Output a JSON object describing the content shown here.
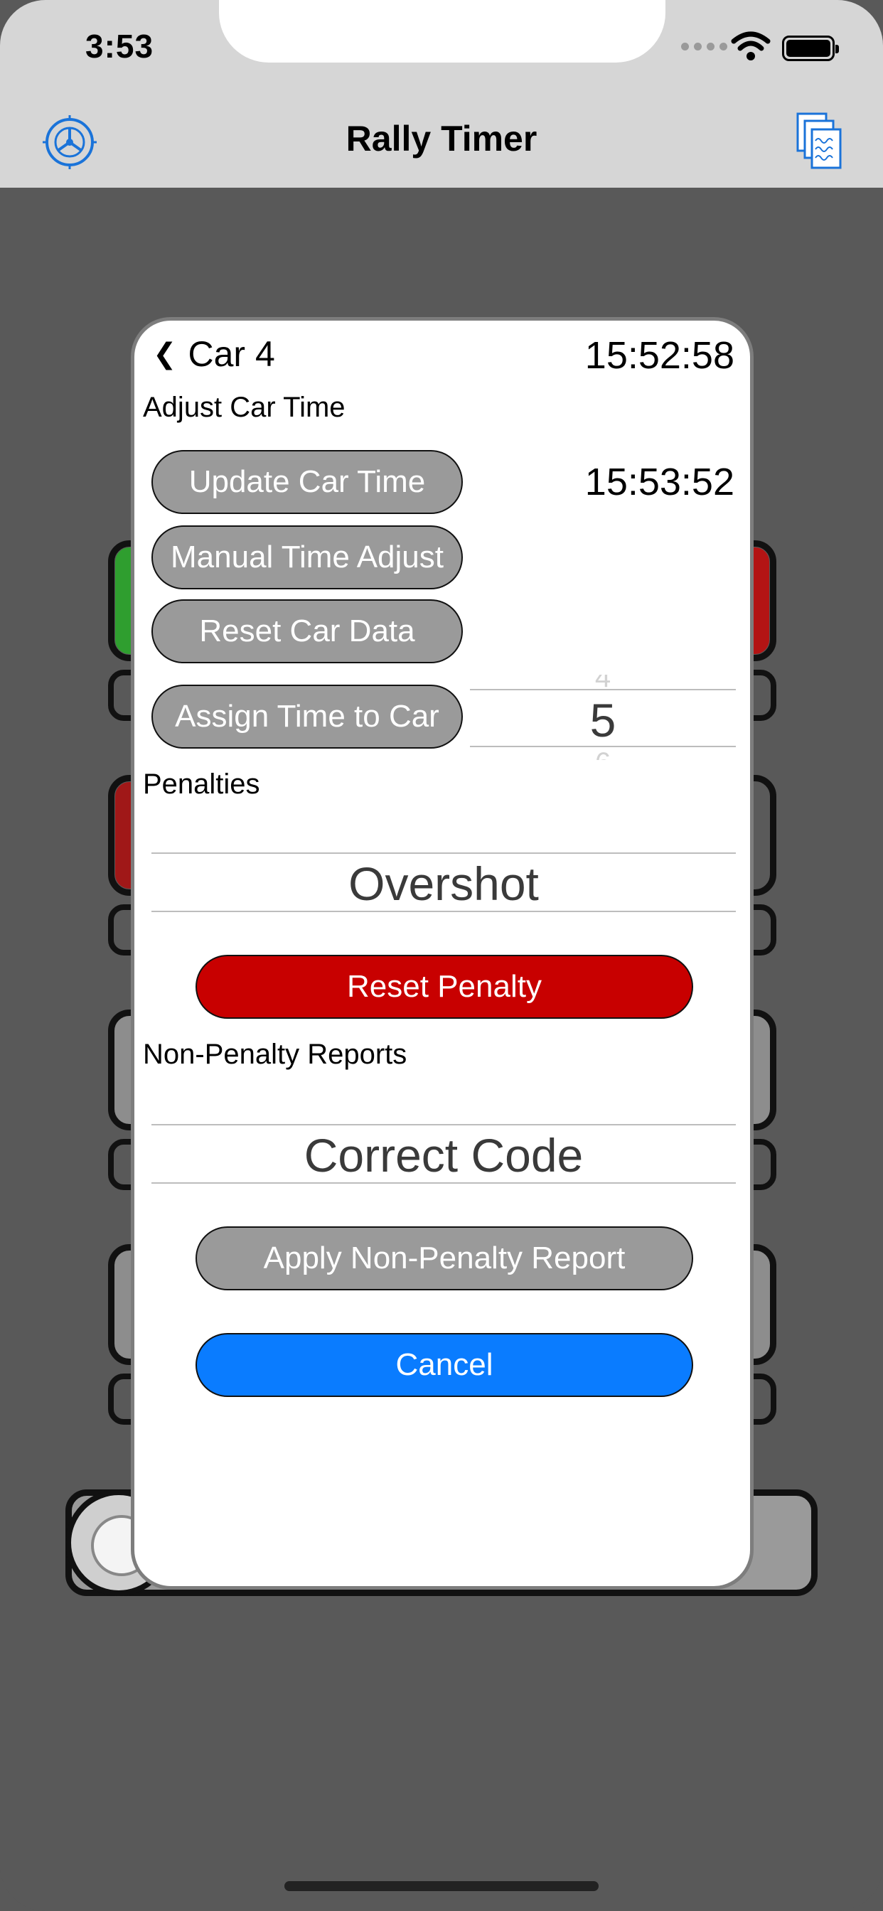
{
  "status_bar": {
    "time": "3:53"
  },
  "nav": {
    "title": "Rally Timer",
    "left_icon": "steering-wheel-icon",
    "right_icon": "documents-icon"
  },
  "modal": {
    "back_label": "Car 4",
    "back_chevron": "❮",
    "current_time": "15:52:58",
    "adjust_section": "Adjust Car Time",
    "update_car_time_label": "Update Car Time",
    "car_time_value": "15:53:52",
    "manual_time_adjust_label": "Manual Time Adjust",
    "reset_car_data_label": "Reset Car Data",
    "assign_time_label": "Assign Time to Car",
    "car_number_picker": {
      "selected": "5"
    },
    "penalties_section": "Penalties",
    "penalty_picker": {
      "selected": "Overshot"
    },
    "reset_penalty_label": "Reset Penalty",
    "non_penalty_section": "Non-Penalty Reports",
    "report_picker": {
      "selected": "Correct Code"
    },
    "apply_report_label": "Apply Non-Penalty Report",
    "cancel_label": "Cancel"
  },
  "colors": {
    "nav_bg": "#d6d6d6",
    "backdrop": "#595959",
    "pill_gray": "#9a9a9a",
    "pill_red": "#c80000",
    "pill_blue": "#0a7cff",
    "icon_blue": "#1a73d9"
  }
}
